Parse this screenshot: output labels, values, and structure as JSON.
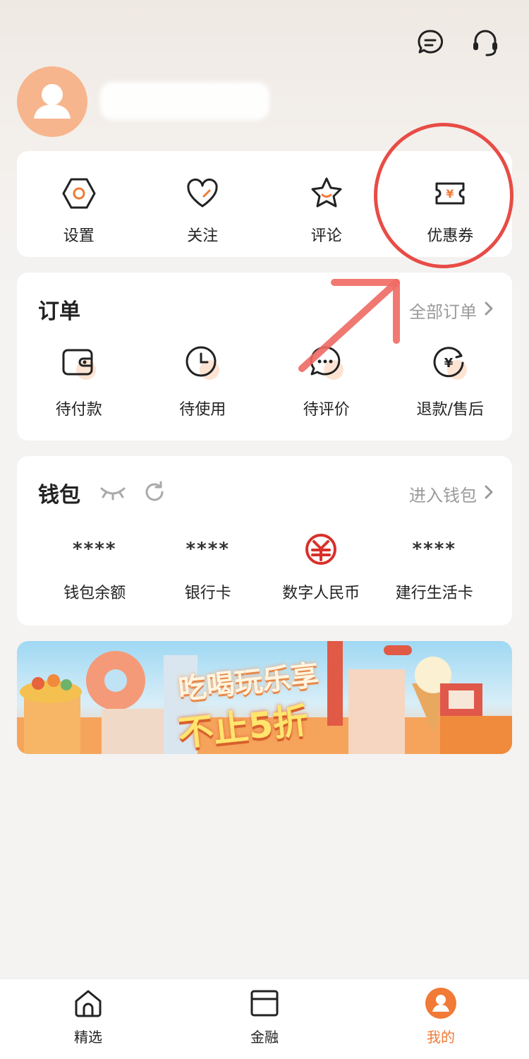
{
  "quick": [
    {
      "label": "设置",
      "icon": "settings-hexagon-icon"
    },
    {
      "label": "关注",
      "icon": "heart-icon"
    },
    {
      "label": "评论",
      "icon": "star-icon"
    },
    {
      "label": "优惠券",
      "icon": "coupon-icon"
    }
  ],
  "orders": {
    "title": "订单",
    "link": "全部订单",
    "items": [
      {
        "label": "待付款",
        "icon": "wallet-icon"
      },
      {
        "label": "待使用",
        "icon": "clock-icon"
      },
      {
        "label": "待评价",
        "icon": "chat-bubble-icon"
      },
      {
        "label": "退款/售后",
        "icon": "refund-icon"
      }
    ]
  },
  "wallet": {
    "title": "钱包",
    "link": "进入钱包",
    "items": [
      {
        "value": "****",
        "label": "钱包余额"
      },
      {
        "value": "****",
        "label": "银行卡"
      },
      {
        "value": "",
        "label": "数字人民币",
        "icon": "digital-rmb-icon"
      },
      {
        "value": "****",
        "label": "建行生活卡"
      }
    ]
  },
  "banner": {
    "line1": "吃喝玩乐享",
    "line2": "不止5折"
  },
  "tabs": [
    {
      "label": "精选",
      "icon": "home-icon",
      "active": false
    },
    {
      "label": "金融",
      "icon": "card-icon",
      "active": false
    },
    {
      "label": "我的",
      "icon": "profile-icon",
      "active": true
    }
  ],
  "colors": {
    "accent": "#f07a36",
    "annotation": "#e84c46"
  }
}
